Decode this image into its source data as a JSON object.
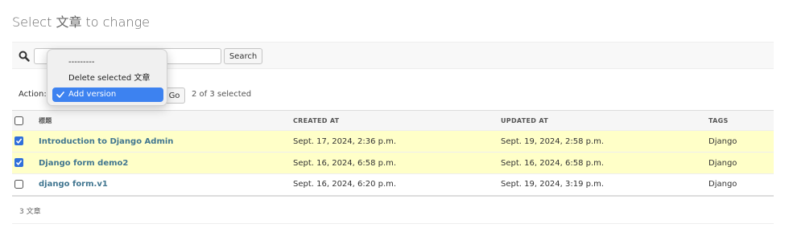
{
  "page": {
    "title": "Select 文章 to change"
  },
  "search": {
    "value": "",
    "placeholder": "",
    "button_label": "Search"
  },
  "actions": {
    "label": "Action:",
    "go_label": "Go",
    "counter": "2 of 3 selected",
    "options": [
      "---------",
      "Delete selected 文章",
      "Add version"
    ],
    "selected_option": "Add version"
  },
  "table": {
    "columns": [
      "標題",
      "CREATED AT",
      "UPDATED AT",
      "TAGS"
    ],
    "rows": [
      {
        "checked": true,
        "title": "Introduction to Django Admin",
        "created_at": "Sept. 17, 2024, 2:36 p.m.",
        "updated_at": "Sept. 19, 2024, 2:58 p.m.",
        "tags": "Django"
      },
      {
        "checked": true,
        "title": "Django form demo2",
        "created_at": "Sept. 16, 2024, 6:58 p.m.",
        "updated_at": "Sept. 16, 2024, 6:58 p.m.",
        "tags": "Django"
      },
      {
        "checked": false,
        "title": "django form.v1",
        "created_at": "Sept. 16, 2024, 6:20 p.m.",
        "updated_at": "Sept. 19, 2024, 3:19 p.m.",
        "tags": "Django"
      }
    ]
  },
  "footer": {
    "count": "3 文章"
  },
  "colors": {
    "link": "#417690",
    "selected_row": "#ffffc8",
    "dropdown_highlight": "#3d82f0",
    "checkbox_accent": "#2f6fdb"
  },
  "icons": {
    "search": "magnifier-icon",
    "checkmark": "checkmark-icon",
    "checkbox": "checkbox-icon"
  }
}
